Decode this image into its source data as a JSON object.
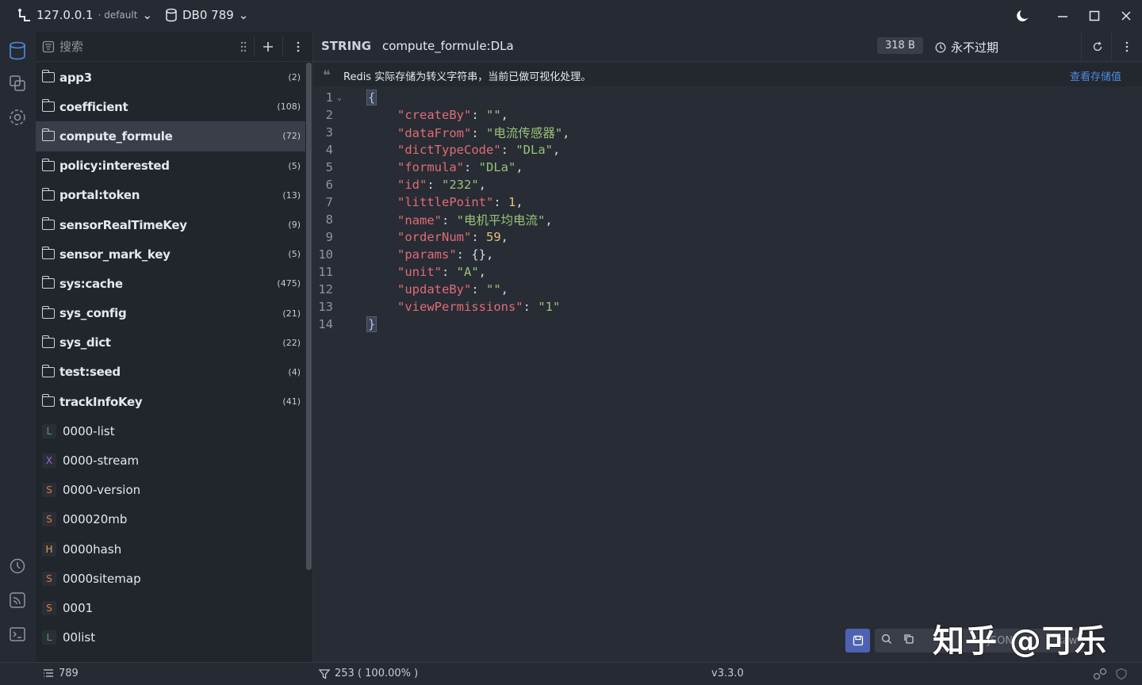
{
  "titlebar": {
    "host": "127.0.0.1",
    "connection_name": "· default",
    "db_label": "DB0 789"
  },
  "keylist": {
    "search_placeholder": "搜索",
    "items": [
      {
        "kind": "folder",
        "name": "app3",
        "count": "(2)"
      },
      {
        "kind": "folder",
        "name": "coefficient",
        "count": "(108)"
      },
      {
        "kind": "folder",
        "name": "compute_formule",
        "count": "(72)",
        "selected": true
      },
      {
        "kind": "folder",
        "name": "policy:interested",
        "count": "(5)"
      },
      {
        "kind": "folder",
        "name": "portal:token",
        "count": "(13)"
      },
      {
        "kind": "folder",
        "name": "sensorRealTimeKey",
        "count": "(9)"
      },
      {
        "kind": "folder",
        "name": "sensor_mark_key",
        "count": "(5)"
      },
      {
        "kind": "folder",
        "name": "sys:cache",
        "count": "(475)"
      },
      {
        "kind": "folder",
        "name": "sys_config",
        "count": "(21)"
      },
      {
        "kind": "folder",
        "name": "sys_dict",
        "count": "(22)"
      },
      {
        "kind": "folder",
        "name": "test:seed",
        "count": "(4)"
      },
      {
        "kind": "folder",
        "name": "trackInfoKey",
        "count": "(41)"
      },
      {
        "kind": "key",
        "type": "L",
        "color": "#4caf50",
        "name": "0000-list"
      },
      {
        "kind": "key",
        "type": "X",
        "color": "#9c6ade",
        "name": "0000-stream"
      },
      {
        "kind": "key",
        "type": "S",
        "color": "#e07a3f",
        "name": "0000-version"
      },
      {
        "kind": "key",
        "type": "S",
        "color": "#e07a3f",
        "name": "000020mb"
      },
      {
        "kind": "key",
        "type": "H",
        "color": "#e0a03f",
        "name": "0000hash"
      },
      {
        "kind": "key",
        "type": "S",
        "color": "#e07a3f",
        "name": "0000sitemap"
      },
      {
        "kind": "key",
        "type": "S",
        "color": "#e07a3f",
        "name": "0001"
      },
      {
        "kind": "key",
        "type": "L",
        "color": "#4caf50",
        "name": "00list"
      }
    ]
  },
  "value": {
    "type_label": "STRING",
    "key_name": "compute_formule:DLa",
    "size": "318 B",
    "ttl": "永不过期",
    "note": "Redis 实际存储为转义字符串，当前已做可视化处理。",
    "note_link": "查看存储值",
    "lines": [
      {
        "n": "1",
        "fold": true
      },
      {
        "n": "2",
        "key": "\"createBy\"",
        "val": "\"\"",
        "vt": "s"
      },
      {
        "n": "3",
        "key": "\"dataFrom\"",
        "val": "\"电流传感器\"",
        "vt": "s"
      },
      {
        "n": "4",
        "key": "\"dictTypeCode\"",
        "val": "\"DLa\"",
        "vt": "s"
      },
      {
        "n": "5",
        "key": "\"formula\"",
        "val": "\"DLa\"",
        "vt": "s"
      },
      {
        "n": "6",
        "key": "\"id\"",
        "val": "\"232\"",
        "vt": "s"
      },
      {
        "n": "7",
        "key": "\"littlePoint\"",
        "val": "1",
        "vt": "n"
      },
      {
        "n": "8",
        "key": "\"name\"",
        "val": "\"电机平均电流\"",
        "vt": "s"
      },
      {
        "n": "9",
        "key": "\"orderNum\"",
        "val": "59",
        "vt": "n"
      },
      {
        "n": "10",
        "key": "\"params\"",
        "val": "{}",
        "vt": "p"
      },
      {
        "n": "11",
        "key": "\"unit\"",
        "val": "\"A\"",
        "vt": "s"
      },
      {
        "n": "12",
        "key": "\"updateBy\"",
        "val": "\"\"",
        "vt": "s"
      },
      {
        "n": "13",
        "key": "\"viewPermissions\"",
        "val": "\"1\"",
        "vt": "s",
        "last": true
      },
      {
        "n": "14"
      }
    ],
    "open_brace": "{",
    "close_brace": "}",
    "format_tabs": [
      "JSON",
      "Raw"
    ]
  },
  "statusbar": {
    "key_count": "789",
    "filter": "253 ( 100.00% )",
    "version": "v3.3.0"
  },
  "watermark": "知乎 @可乐",
  "icons": {
    "connection": "connection-icon",
    "database": "database-icon",
    "moon": "moon-icon"
  }
}
